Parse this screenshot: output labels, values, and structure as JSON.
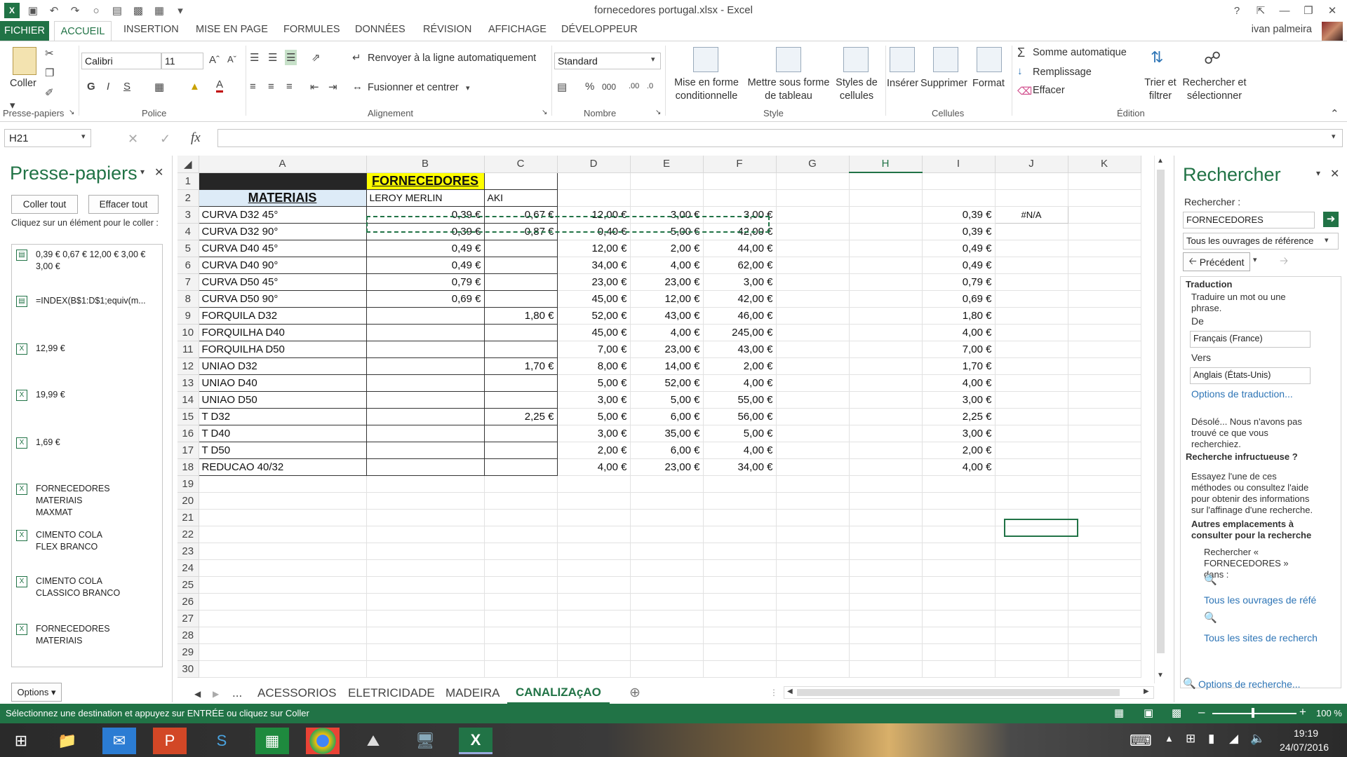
{
  "window": {
    "title": "fornecedores portugal.xlsx - Excel",
    "help": "?",
    "user": "ivan palmeira"
  },
  "tabs": [
    {
      "label": "FICHIER"
    },
    {
      "label": "ACCUEIL"
    },
    {
      "label": "INSERTION"
    },
    {
      "label": "MISE EN PAGE"
    },
    {
      "label": "FORMULES"
    },
    {
      "label": "DONNÉES"
    },
    {
      "label": "RÉVISION"
    },
    {
      "label": "AFFICHAGE"
    },
    {
      "label": "DÉVELOPPEUR"
    }
  ],
  "ribbon": {
    "paste": "Coller",
    "font_name": "Calibri",
    "font_size": "11",
    "bold": "G",
    "italic": "I",
    "underline": "S",
    "wrap": "Renvoyer à la ligne automatiquement",
    "merge": "Fusionner et centrer",
    "number_format": "Standard",
    "cond_format": "Mise en forme conditionnelle",
    "table_format": "Mettre sous forme de tableau",
    "cell_styles": "Styles de cellules",
    "insert": "Insérer",
    "delete": "Supprimer",
    "format": "Format",
    "autosum": "Somme automatique",
    "fill": "Remplissage",
    "clear": "Effacer",
    "sort": "Trier et filtrer",
    "find": "Rechercher et sélectionner",
    "groups": {
      "clipboard": "Presse-papiers",
      "font": "Police",
      "alignment": "Alignement",
      "number": "Nombre",
      "style": "Style",
      "cells": "Cellules",
      "editing": "Édition"
    }
  },
  "formula": {
    "namebox": "H21",
    "fx": "fx",
    "value": ""
  },
  "clipboard": {
    "title": "Presse-papiers",
    "paste_all": "Coller tout",
    "clear_all": "Effacer tout",
    "hint": "Cliquez sur un élément pour le coller :",
    "items": [
      "0,39 € 0,67 € 12,00 € 3,00 € 3,00 €",
      "=INDEX(B$1:D$1;equiv(m...",
      "12,99 €",
      "19,99 €",
      "1,69 €",
      "FORNECEDORES MATERIAIS MAXMAT",
      "CIMENTO COLA FLEX BRANCO",
      "CIMENTO COLA CLASSICO BRANCO",
      "FORNECEDORES MATERIAIS"
    ],
    "options": "Options"
  },
  "columns": [
    "A",
    "B",
    "C",
    "D",
    "E",
    "F",
    "G",
    "H",
    "I",
    "J",
    "K"
  ],
  "sheet": {
    "header_materiais": "MATERIAIS",
    "header_fornecedores": "FORNECEDORES",
    "b2": "LEROY MERLIN",
    "c2": "AKI",
    "j3": "#N/A",
    "rows": [
      {
        "r": "3",
        "a": "CURVA D32 45°",
        "b": "0,39 €",
        "c": "0,67 €",
        "d": "12,00 €",
        "e": "3,00 €",
        "f": "3,00 €",
        "i": "0,39 €"
      },
      {
        "r": "4",
        "a": "CURVA D32 90°",
        "b": "0,39 €",
        "c": "0,87 €",
        "d": "0,40 €",
        "e": "5,00 €",
        "f": "42,00 €",
        "i": "0,39 €"
      },
      {
        "r": "5",
        "a": "CURVA D40 45°",
        "b": "0,49 €",
        "c": "",
        "d": "12,00 €",
        "e": "2,00 €",
        "f": "44,00 €",
        "i": "0,49 €"
      },
      {
        "r": "6",
        "a": "CURVA D40 90°",
        "b": "0,49 €",
        "c": "",
        "d": "34,00 €",
        "e": "4,00 €",
        "f": "62,00 €",
        "i": "0,49 €"
      },
      {
        "r": "7",
        "a": "CURVA D50 45°",
        "b": "0,79 €",
        "c": "",
        "d": "23,00 €",
        "e": "23,00 €",
        "f": "3,00 €",
        "i": "0,79 €"
      },
      {
        "r": "8",
        "a": "CURVA D50 90°",
        "b": "0,69 €",
        "c": "",
        "d": "45,00 €",
        "e": "12,00 €",
        "f": "42,00 €",
        "i": "0,69 €"
      },
      {
        "r": "9",
        "a": "FORQUILA D32",
        "b": "",
        "c": "1,80 €",
        "d": "52,00 €",
        "e": "43,00 €",
        "f": "46,00 €",
        "i": "1,80 €"
      },
      {
        "r": "10",
        "a": "FORQUILHA D40",
        "b": "",
        "c": "",
        "d": "45,00 €",
        "e": "4,00 €",
        "f": "245,00 €",
        "i": "4,00 €"
      },
      {
        "r": "11",
        "a": "FORQUILHA D50",
        "b": "",
        "c": "",
        "d": "7,00 €",
        "e": "23,00 €",
        "f": "43,00 €",
        "i": "7,00 €"
      },
      {
        "r": "12",
        "a": "UNIAO D32",
        "b": "",
        "c": "1,70 €",
        "d": "8,00 €",
        "e": "14,00 €",
        "f": "2,00 €",
        "i": "1,70 €"
      },
      {
        "r": "13",
        "a": "UNIAO D40",
        "b": "",
        "c": "",
        "d": "5,00 €",
        "e": "52,00 €",
        "f": "4,00 €",
        "i": "4,00 €"
      },
      {
        "r": "14",
        "a": "UNIAO D50",
        "b": "",
        "c": "",
        "d": "3,00 €",
        "e": "5,00 €",
        "f": "55,00 €",
        "i": "3,00 €"
      },
      {
        "r": "15",
        "a": "T D32",
        "b": "",
        "c": "2,25 €",
        "d": "5,00 €",
        "e": "6,00 €",
        "f": "56,00 €",
        "i": "2,25 €"
      },
      {
        "r": "16",
        "a": "T D40",
        "b": "",
        "c": "",
        "d": "3,00 €",
        "e": "35,00 €",
        "f": "5,00 €",
        "i": "3,00 €"
      },
      {
        "r": "17",
        "a": "T D50",
        "b": "",
        "c": "",
        "d": "2,00 €",
        "e": "6,00 €",
        "f": "4,00 €",
        "i": "2,00 €"
      },
      {
        "r": "18",
        "a": "REDUCAO 40/32",
        "b": "",
        "c": "",
        "d": "4,00 €",
        "e": "23,00 €",
        "f": "34,00 €",
        "i": "4,00 €"
      }
    ],
    "empty_rows": [
      "19",
      "20",
      "21",
      "22",
      "23",
      "24",
      "25",
      "26",
      "27",
      "28",
      "29",
      "30"
    ]
  },
  "search": {
    "title": "Rechercher",
    "label": "Rechercher :",
    "query": "FORNECEDORES",
    "scope": "Tous les ouvrages de référence",
    "prev": "Précédent",
    "translation": "Traduction",
    "translate_hint": "Traduire un mot ou une phrase.",
    "from_label": "De",
    "from": "Français (France)",
    "to_label": "Vers",
    "to": "Anglais (États-Unis)",
    "trans_options": "Options de traduction...",
    "sorry": "Désolé... Nous n'avons pas trouvé ce que vous recherchiez.",
    "failed": "Recherche infructueuse ?",
    "try": "Essayez l'une de ces méthodes ou consultez l'aide pour obtenir des informations sur l'affinage d'une recherche.",
    "other": "Autres emplacements à consulter pour la recherche",
    "search_in": "Rechercher « FORNECEDORES » dans :",
    "all_refs": "Tous les ouvrages de réfé",
    "all_sites": "Tous les sites de recherch",
    "search_options": "Options de recherche..."
  },
  "sheet_tabs": {
    "ellipsis": "...",
    "tabs": [
      "ACESSORIOS",
      "ELETRICIDADE",
      "MADEIRA",
      "CANALIZAçAO"
    ],
    "active": "CANALIZAçAO"
  },
  "status": {
    "message": "Sélectionnez une destination et appuyez sur ENTRÉE ou cliquez sur Coller",
    "zoom": "100 %"
  },
  "taskbar": {
    "time": "19:19",
    "date": "24/07/2016"
  }
}
